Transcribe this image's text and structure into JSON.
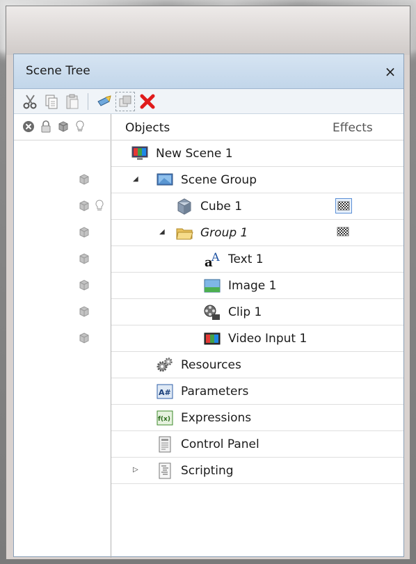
{
  "panel": {
    "title": "Scene Tree",
    "close_glyph": "×"
  },
  "toolbar": {
    "buttons": [
      "cut-icon",
      "copy-icon",
      "paste-icon",
      "rename-icon",
      "group-icon",
      "delete-icon"
    ]
  },
  "columns": {
    "objects": "Objects",
    "effects": "Effects",
    "state_icons": [
      "visibility-x-icon",
      "lock-icon",
      "cube-render-icon",
      "bulb-icon"
    ]
  },
  "tree": [
    {
      "label": "New Scene 1",
      "icon": "scene-icon",
      "level": 0,
      "expander": "",
      "italic": false,
      "cube": false,
      "bulb": false,
      "effect": ""
    },
    {
      "label": "Scene Group",
      "icon": "monitor-icon",
      "level": 1,
      "expander": "◢",
      "italic": false,
      "cube": true,
      "bulb": false,
      "effect": ""
    },
    {
      "label": "Cube 1",
      "icon": "cube-icon",
      "level": 2,
      "expander": "",
      "italic": false,
      "cube": true,
      "bulb": true,
      "effect": "checker-selected"
    },
    {
      "label": "Group 1",
      "icon": "folder-icon",
      "level": 2,
      "expander": "◢",
      "italic": true,
      "cube": true,
      "bulb": false,
      "effect": "checker"
    },
    {
      "label": "Text 1",
      "icon": "text-icon",
      "level": 3,
      "expander": "",
      "italic": false,
      "cube": true,
      "bulb": false,
      "effect": ""
    },
    {
      "label": "Image 1",
      "icon": "image-icon",
      "level": 3,
      "expander": "",
      "italic": false,
      "cube": true,
      "bulb": false,
      "effect": ""
    },
    {
      "label": "Clip 1",
      "icon": "film-reel-icon",
      "level": 3,
      "expander": "",
      "italic": false,
      "cube": true,
      "bulb": false,
      "effect": ""
    },
    {
      "label": "Video Input 1",
      "icon": "video-input-icon",
      "level": 3,
      "expander": "",
      "italic": false,
      "cube": true,
      "bulb": false,
      "effect": ""
    },
    {
      "label": "Resources",
      "icon": "gears-icon",
      "level": 1,
      "expander": "",
      "italic": false,
      "cube": false,
      "bulb": false,
      "effect": ""
    },
    {
      "label": "Parameters",
      "icon": "parameters-icon",
      "level": 1,
      "expander": "",
      "italic": false,
      "cube": false,
      "bulb": false,
      "effect": ""
    },
    {
      "label": "Expressions",
      "icon": "expressions-icon",
      "level": 1,
      "expander": "",
      "italic": false,
      "cube": false,
      "bulb": false,
      "effect": ""
    },
    {
      "label": "Control Panel",
      "icon": "control-panel-icon",
      "level": 1,
      "expander": "",
      "italic": false,
      "cube": false,
      "bulb": false,
      "effect": ""
    },
    {
      "label": "Scripting",
      "icon": "scripting-icon",
      "level": 1,
      "expander": "▷",
      "italic": false,
      "cube": false,
      "bulb": false,
      "effect": ""
    }
  ],
  "icon_texts": {
    "parameters": "A#",
    "expressions": "f(x)"
  },
  "colors": {
    "titlebar": "#c8daed",
    "delete": "#e01b1b",
    "panel_border": "#8aa0b8"
  }
}
